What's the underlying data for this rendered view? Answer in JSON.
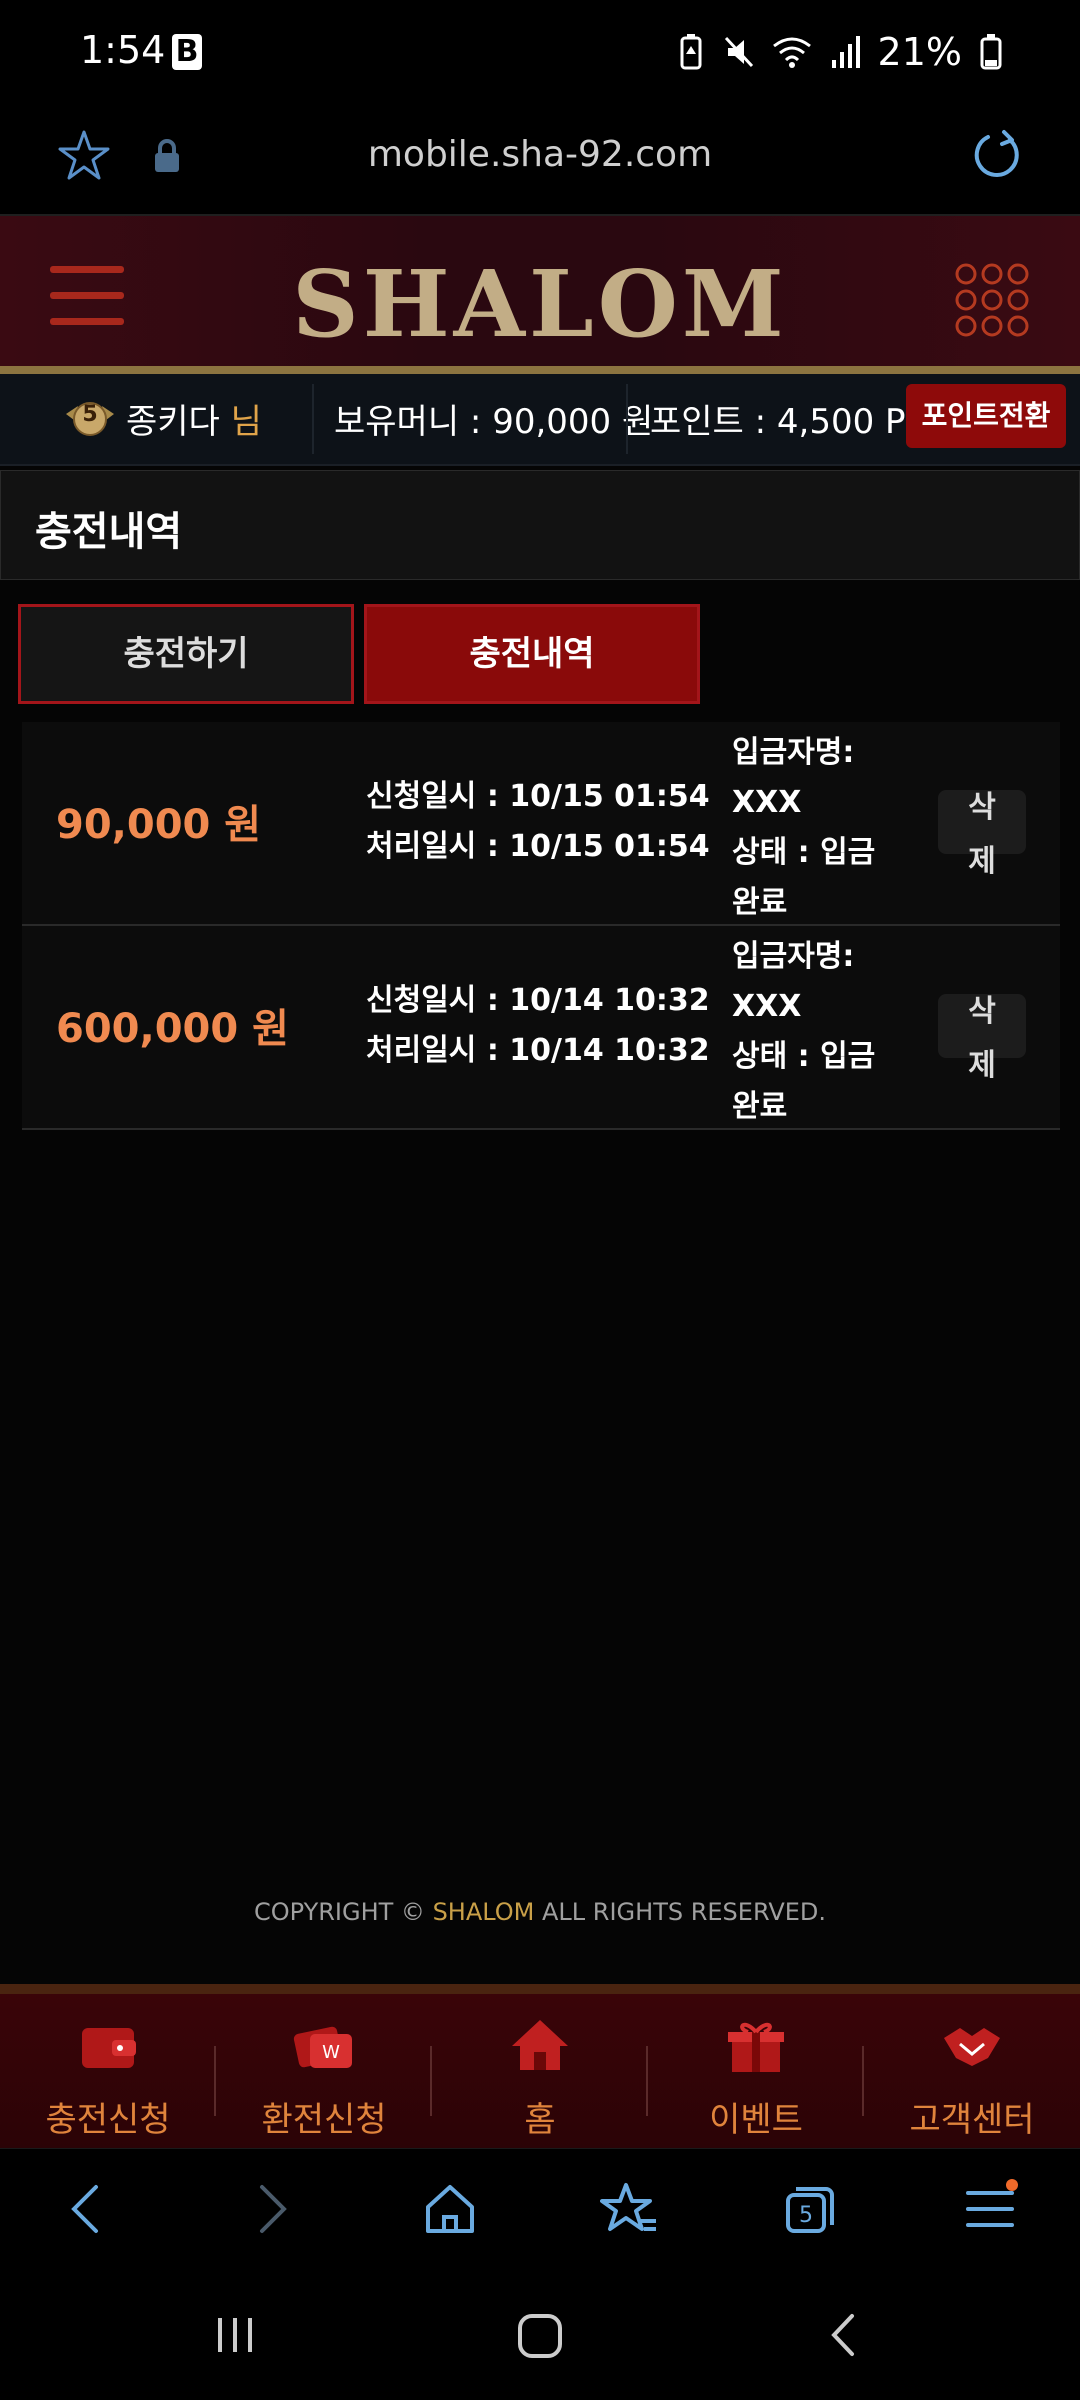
{
  "status_bar": {
    "time": "1:54",
    "app_letter": "B",
    "battery": "21%"
  },
  "browser": {
    "url": "mobile.sha-92.com"
  },
  "site": {
    "logo": "SHALOM"
  },
  "user": {
    "level": "5",
    "name": "종키다",
    "suffix": "님",
    "money_label": "보유머니 : 90,000 원",
    "points_label": "포인트 : 4,500 P",
    "convert_label": "포인트전환"
  },
  "page": {
    "title": "충전내역"
  },
  "tabs": [
    {
      "label": "충전하기"
    },
    {
      "label": "충전내역"
    }
  ],
  "records": [
    {
      "amount": "90,000 원",
      "request": "신청일시 : 10/15 01:54",
      "processed": "처리일시 : 10/15 01:54",
      "depositor_label": "입금자명:",
      "depositor": "XXX",
      "status_line1": "상태 : 입금",
      "status_line2": "완료",
      "delete_1": "삭",
      "delete_2": "제"
    },
    {
      "amount": "600,000 원",
      "request": "신청일시 : 10/14 10:32",
      "processed": "처리일시 : 10/14 10:32",
      "depositor_label": "입금자명:",
      "depositor": "XXX",
      "status_line1": "상태 : 입금",
      "status_line2": "완료",
      "delete_1": "삭",
      "delete_2": "제"
    }
  ],
  "footer": {
    "prefix": "COPYRIGHT © ",
    "brand": "SHALOM",
    "suffix": " ALL RIGHTS RESERVED."
  },
  "bottom_nav": [
    {
      "label": "충전신청",
      "icon": "wallet-icon"
    },
    {
      "label": "환전신청",
      "icon": "exchange-card-icon"
    },
    {
      "label": "홈",
      "icon": "home-icon"
    },
    {
      "label": "이벤트",
      "icon": "gift-icon"
    },
    {
      "label": "고객센터",
      "icon": "handshake-icon"
    }
  ],
  "colors": {
    "accent_red": "#8a0a0a",
    "amount_orange": "#f08a50",
    "gold": "#c2ad86",
    "nav_label": "#e0843c"
  }
}
